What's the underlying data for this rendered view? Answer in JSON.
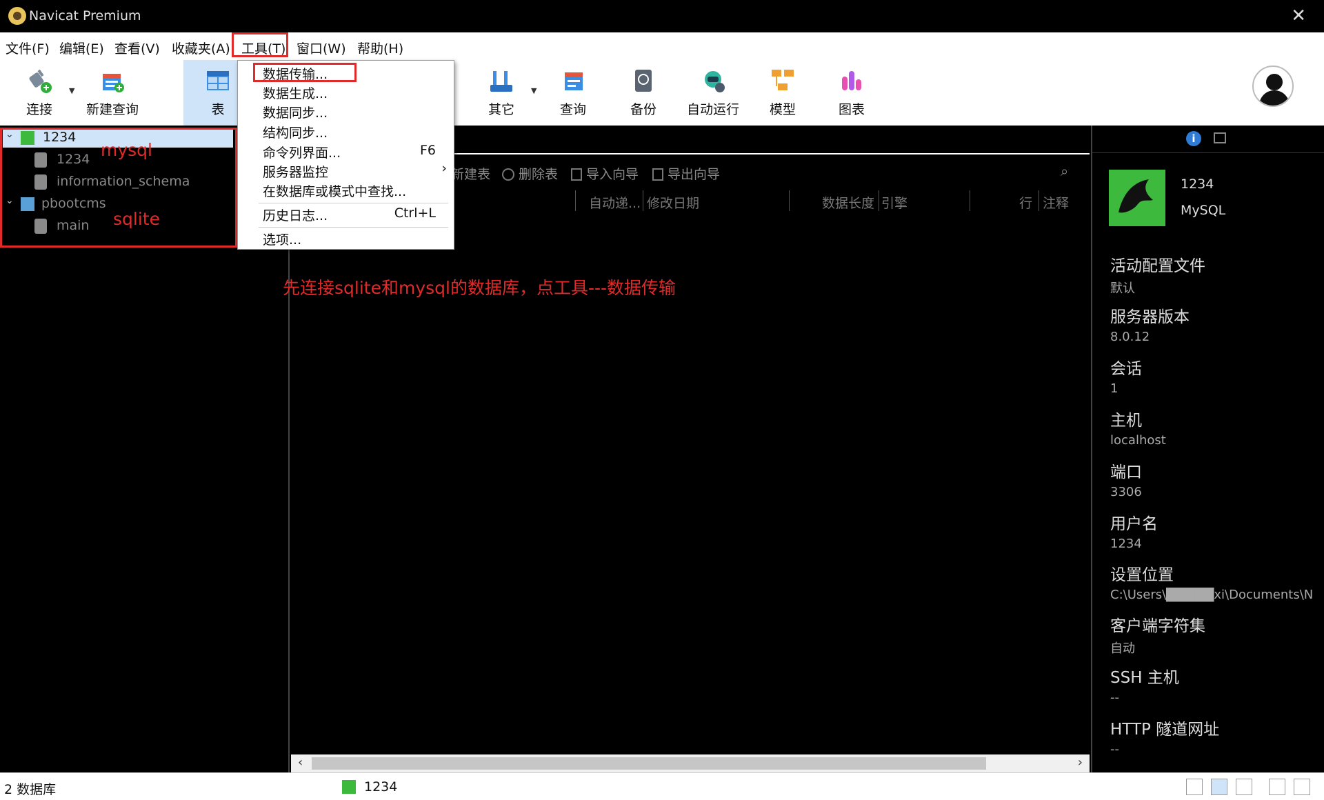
{
  "window": {
    "title": "Navicat Premium",
    "close": "✕"
  },
  "menu": [
    {
      "label": "文件(F)"
    },
    {
      "label": "编辑(E)"
    },
    {
      "label": "查看(V)"
    },
    {
      "label": "收藏夹(A)"
    },
    {
      "label": "工具(T)"
    },
    {
      "label": "窗口(W)"
    },
    {
      "label": "帮助(H)"
    }
  ],
  "toolbar": [
    {
      "label": "连接",
      "icon": "connection-plug-icon"
    },
    {
      "label": "新建查询",
      "icon": "new-query-icon"
    },
    {
      "label": "表",
      "icon": "table-icon"
    },
    {
      "label": "其它",
      "icon": "other-tools-icon"
    },
    {
      "label": "查询",
      "icon": "query-icon"
    },
    {
      "label": "备份",
      "icon": "backup-icon"
    },
    {
      "label": "自动运行",
      "icon": "robot-icon"
    },
    {
      "label": "模型",
      "icon": "model-icon"
    },
    {
      "label": "图表",
      "icon": "chart-icon"
    }
  ],
  "tools_menu": {
    "items": [
      {
        "label": "数据传输...",
        "shortcut": ""
      },
      {
        "label": "数据生成...",
        "shortcut": ""
      },
      {
        "label": "数据同步...",
        "shortcut": ""
      },
      {
        "label": "结构同步...",
        "shortcut": ""
      },
      {
        "label": "命令列界面...",
        "shortcut": "F6"
      },
      {
        "label": "服务器监控",
        "shortcut": ""
      },
      {
        "label": "在数据库或模式中查找...",
        "shortcut": ""
      },
      {
        "label": "历史日志...",
        "shortcut": "Ctrl+L"
      },
      {
        "label": "选项...",
        "shortcut": ""
      }
    ],
    "submenu_arrow": "›"
  },
  "nav": {
    "tree": [
      {
        "label": "1234",
        "type": "mysql-connection"
      },
      {
        "label": "1234",
        "type": "database"
      },
      {
        "label": "information_schema",
        "type": "database"
      },
      {
        "label": "pbootcms",
        "type": "sqlite-connection"
      },
      {
        "label": "main",
        "type": "database"
      }
    ],
    "annotations": {
      "mysql": "mysql",
      "sqlite": "sqlite"
    }
  },
  "main": {
    "actions": [
      "新建表",
      "删除表",
      "导入向导",
      "导出向导"
    ],
    "columns": [
      "自动递...",
      "修改日期",
      "数据长度",
      "引擎",
      "行",
      "注释"
    ],
    "instruction": "先连接sqlite和mysql的数据库，点工具---数据传输"
  },
  "info": {
    "connection_name": "1234",
    "connection_type": "MySQL",
    "props": [
      {
        "key": "活动配置文件",
        "value": "默认"
      },
      {
        "key": "服务器版本",
        "value": "8.0.12"
      },
      {
        "key": "会话",
        "value": "1"
      },
      {
        "key": "主机",
        "value": "localhost"
      },
      {
        "key": "端口",
        "value": "3306"
      },
      {
        "key": "用户名",
        "value": "1234"
      },
      {
        "key": "设置位置",
        "value": "C:\\Users\\█████xi\\Documents\\N"
      },
      {
        "key": "客户端字符集",
        "value": "自动"
      },
      {
        "key": "SSH 主机",
        "value": "--"
      },
      {
        "key": "HTTP 隧道网址",
        "value": "--"
      }
    ]
  },
  "status": {
    "left": "2 数据库",
    "connection": "1234"
  },
  "colors": {
    "accent": "#cfe4f8",
    "annotation": "#e12b2b",
    "mysql": "#3dba3d"
  }
}
